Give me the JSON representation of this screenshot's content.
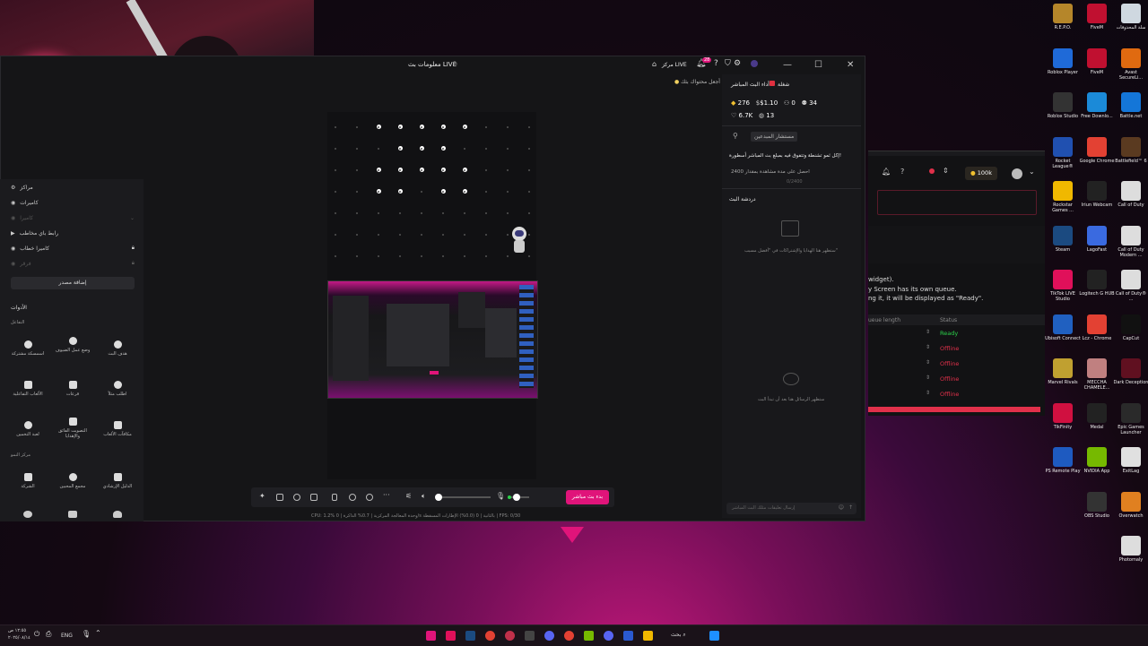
{
  "colors": {
    "accent": "#e0147a",
    "ready": "#2bd14a",
    "offline": "#e0304a"
  },
  "app": {
    "title": "معلومات بث LIVE",
    "live_center": "مركز LIVE",
    "notif_badge": "28",
    "tip": "أجعل محتواك بثك"
  },
  "left_panel": {
    "items": [
      {
        "label": "مراكز",
        "icon": "settings-icon"
      },
      {
        "label": "كاميرات",
        "icon": "camera-icon"
      },
      {
        "label": "كاميرا",
        "icon": "camera-icon"
      },
      {
        "label": "رابط باي مخاطب",
        "icon": "play-icon"
      },
      {
        "label": "كاميرا خطاب",
        "icon": "camera-icon"
      },
      {
        "label": "فرقر",
        "icon": "camera-icon"
      }
    ],
    "add_source": "إضافة مصدر",
    "tools_heading": "الأدوات",
    "interaction_heading": "التفاعل",
    "tools": [
      {
        "label": "اسمسكة مشتركة",
        "icon": "link-icon"
      },
      {
        "label": "وضع عمل الضيوف",
        "icon": "user-icon"
      },
      {
        "label": "هدف البث",
        "icon": "target-icon"
      },
      {
        "label": "الألعاب التفاعلية",
        "icon": "gamepad-icon"
      },
      {
        "label": "قرعات",
        "icon": "gift-icon"
      },
      {
        "label": "اطلب مثلاً",
        "icon": "person-icon"
      },
      {
        "label": "لعبة التخمين",
        "icon": "question-icon"
      },
      {
        "label": "التصويت الفائق والإهدايا",
        "icon": "poll-icon"
      },
      {
        "label": "مكافآت الألعاب",
        "icon": "trophy-icon"
      }
    ],
    "growth_heading": "مركز النمو",
    "growth_tools": [
      {
        "label": "الشركة",
        "icon": "gamepad-icon"
      },
      {
        "label": "مجمع المحبين",
        "icon": "heart-icon"
      },
      {
        "label": "الدليل الإرشادي",
        "icon": "book-icon"
      }
    ]
  },
  "controls": {
    "go_live": "بدء بث مباشر",
    "stats": "CPU: 1.2% وحدة المعالجة المركزية  |  0.7% الذاكرة  |  0/s بالثانية  |  0 (0.0%) الإطارات المسقطة  |  FPS: 0/30"
  },
  "right_panel": {
    "perf_title": "أداء البث المباشر",
    "share_label": "شغلة",
    "stats": [
      {
        "value": "34",
        "icon": "people-icon"
      },
      {
        "value": "0",
        "icon": "user-icon"
      },
      {
        "value": "$1.10",
        "icon": "dollar-icon"
      },
      {
        "value": "276",
        "icon": "diamond-icon"
      },
      {
        "value": "13",
        "icon": "chat-icon"
      },
      {
        "value": "6.7K",
        "icon": "heart-icon"
      }
    ],
    "creator_hub": "مستشار المبدعين",
    "promo": "إكل ثمو تشنطة وتتفوق فيه بمبلغ بث المباشر أسطورة!",
    "goal_text": "احصل على مدة مشاهدة بمقدار 2400",
    "goal_progress": "0/2400",
    "chat_title": "دردشة البث",
    "gifts_empty": "ستظهر هنا الهدايا والإشتراكات في \"أفضل مسيب\"",
    "chat_empty": "ستظهر الرسائل هنا بعد أن تبدأ البث",
    "chat_placeholder": "إرسال تعليقات مثلك البث المباشر"
  },
  "secondary_window": {
    "text1": "widget).",
    "text2": "y Screen has its own queue.",
    "text3": "ng it, it will be displayed as \"Ready\".",
    "col_queue": "ueue length",
    "col_status": "Status",
    "coins": "100k",
    "statuses": [
      "Ready",
      "Offline",
      "Offline",
      "Offline",
      "Offline"
    ]
  },
  "desktop_icons": [
    {
      "label": "R.E.P.O.",
      "color": "#b5862a"
    },
    {
      "label": "FiveM",
      "color": "#c01030"
    },
    {
      "label": "سلة المحذوفات",
      "color": "#cfd8e0"
    },
    {
      "label": "Roblox Player",
      "color": "#1f6ad8"
    },
    {
      "label": "FiveM",
      "color": "#c01030"
    },
    {
      "label": "Avast SecureLi...",
      "color": "#e06a10"
    },
    {
      "label": "Roblox Studio",
      "color": "#333"
    },
    {
      "label": "Free Downlo...",
      "color": "#1b8ad8"
    },
    {
      "label": "Battle.net",
      "color": "#1476d8"
    },
    {
      "label": "Rocket League®",
      "color": "#2050b0"
    },
    {
      "label": "Google Chrome",
      "color": "#e34133"
    },
    {
      "label": "Battlefield™ 6",
      "color": "#5a3a20"
    },
    {
      "label": "Rockstar Games ...",
      "color": "#f0b800"
    },
    {
      "label": "Iriun Webcam",
      "color": "#222"
    },
    {
      "label": "Call of Duty",
      "color": "#ddd"
    },
    {
      "label": "Steam",
      "color": "#1b4a80"
    },
    {
      "label": "LagoFast",
      "color": "#3a6ae0"
    },
    {
      "label": "Call of Duty Modern ...",
      "color": "#ddd"
    },
    {
      "label": "TikTok LIVE Studio",
      "color": "#e0105a"
    },
    {
      "label": "Logitech G HUB",
      "color": "#222"
    },
    {
      "label": "Call of Duty® ...",
      "color": "#ddd"
    },
    {
      "label": "Ubisoft Connect",
      "color": "#2060c0"
    },
    {
      "label": "Lcz - Chrome",
      "color": "#e34133"
    },
    {
      "label": "CapCut",
      "color": "#111"
    },
    {
      "label": "Marvel Rivals",
      "color": "#c0a030"
    },
    {
      "label": "MECCHA CHAMELE...",
      "color": "#c08080"
    },
    {
      "label": "Dark Deception",
      "color": "#601020"
    },
    {
      "label": "TikFinity",
      "color": "#d01040"
    },
    {
      "label": "Medal",
      "color": "#222"
    },
    {
      "label": "Epic Games Launcher",
      "color": "#2a2a2a"
    },
    {
      "label": "PS Remote Play",
      "color": "#1e5ac0"
    },
    {
      "label": "NVIDIA App",
      "color": "#76b900"
    },
    {
      "label": "ExitLag",
      "color": "#e0e0e0"
    },
    {
      "label": "OBS Studio",
      "color": "#333"
    },
    {
      "label": "Overwatch",
      "color": "#e08020"
    },
    {
      "label": "Photomaly",
      "color": "#ddd"
    }
  ],
  "taskbar": {
    "time": "١٢:٥٥ ص",
    "date": "٢٠٢٥/٠٨/١٤",
    "lang": "ENG",
    "search": "بحث"
  }
}
